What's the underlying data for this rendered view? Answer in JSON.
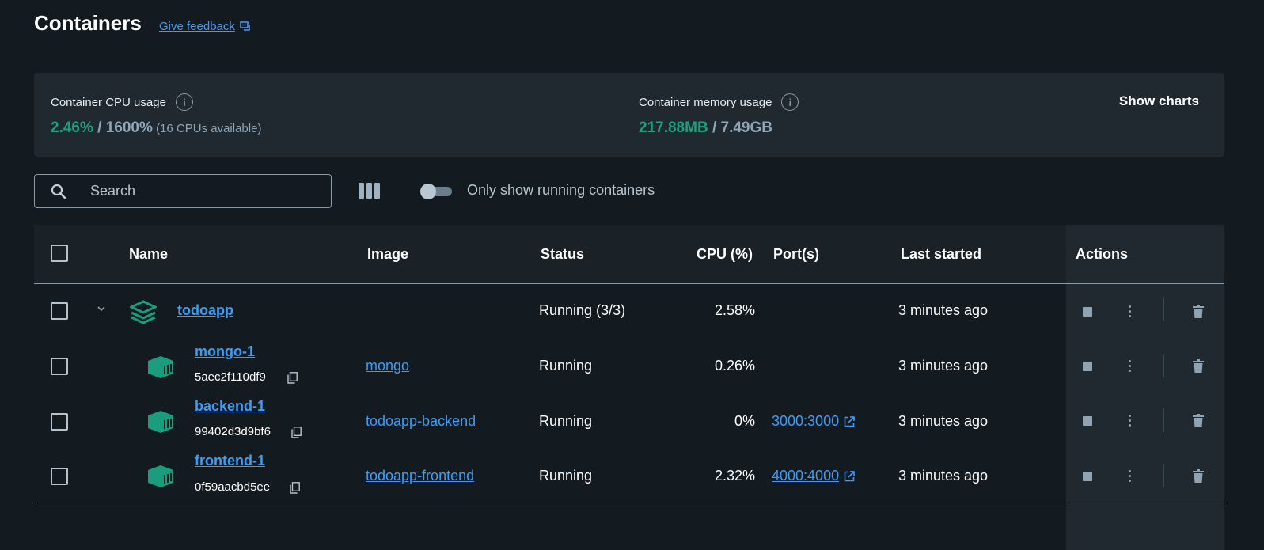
{
  "page": {
    "title": "Containers",
    "feedback_label": "Give feedback"
  },
  "stats": {
    "cpu_label": "Container CPU usage",
    "cpu_used": "2.46%",
    "cpu_sep": " / ",
    "cpu_total": "1600%",
    "cpu_note": " (16 CPUs available)",
    "mem_label": "Container memory usage",
    "mem_used": "217.88MB",
    "mem_sep": " / ",
    "mem_total": "7.49GB",
    "show_charts_label": "Show charts"
  },
  "toolbar": {
    "search_placeholder": "Search",
    "toggle_label": "Only show running containers",
    "toggle_on": false
  },
  "table": {
    "headers": {
      "name": "Name",
      "image": "Image",
      "status": "Status",
      "cpu": "CPU (%)",
      "ports": "Port(s)",
      "last_started": "Last started",
      "actions": "Actions"
    },
    "group": {
      "name": "todoapp",
      "status": "Running (3/3)",
      "cpu": "2.58%",
      "last_started": "3 minutes ago"
    },
    "rows": [
      {
        "name": "mongo-1",
        "id": "5aec2f110df9",
        "image": "mongo",
        "status": "Running",
        "cpu": "0.26%",
        "port": "",
        "last_started": "3 minutes ago"
      },
      {
        "name": "backend-1",
        "id": "99402d3d9bf6",
        "image": "todoapp-backend",
        "status": "Running",
        "cpu": "0%",
        "port": "3000:3000",
        "last_started": "3 minutes ago"
      },
      {
        "name": "frontend-1",
        "id": "0f59aacbd5ee",
        "image": "todoapp-frontend",
        "status": "Running",
        "cpu": "2.32%",
        "port": "4000:4000",
        "last_started": "3 minutes ago"
      }
    ]
  },
  "colors": {
    "accent_link": "#3d9cf4",
    "accent_green": "#1fa07f",
    "container_icon": "#1a9c7e"
  },
  "icons": {
    "feedback": "feedback-icon",
    "info": "info-icon",
    "search": "search-icon",
    "columns": "columns-icon",
    "stack": "stack-icon",
    "container": "container-icon",
    "copy": "copy-icon",
    "external_link": "external-link-icon",
    "stop": "stop-icon",
    "more": "more-vert-icon",
    "delete": "delete-icon",
    "expand": "chevron-down-icon"
  }
}
